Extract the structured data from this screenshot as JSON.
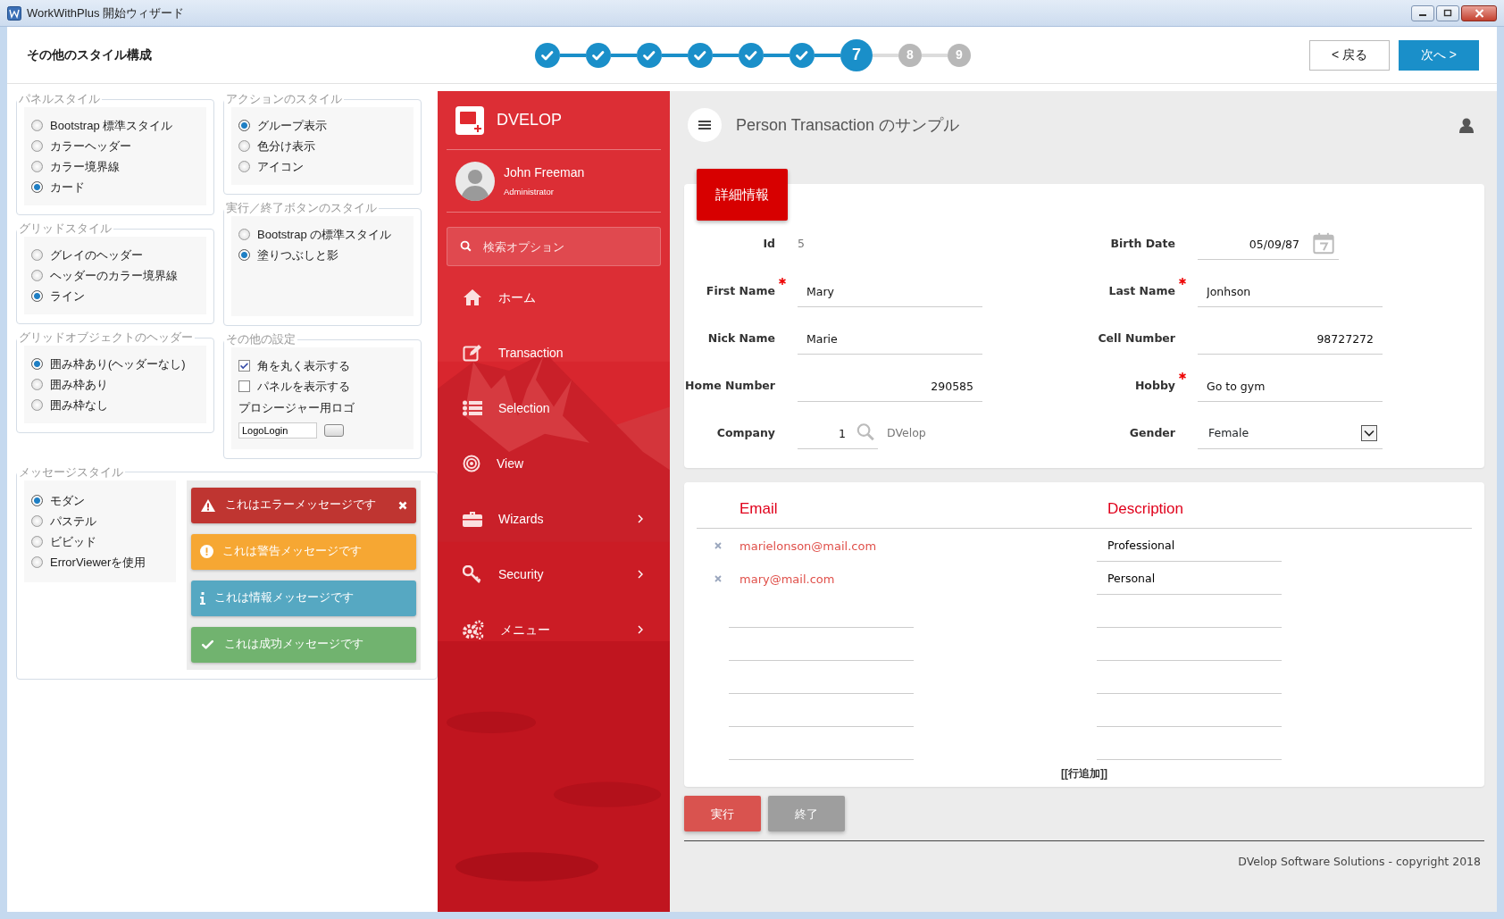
{
  "window": {
    "title": "WorkWithPlus 開始ウィザード"
  },
  "header": {
    "title": "その他のスタイル構成",
    "steps": [
      {
        "done": true,
        "selected": false
      },
      {
        "done": true,
        "selected": false
      },
      {
        "done": true,
        "selected": false
      },
      {
        "done": true,
        "selected": false
      },
      {
        "done": true,
        "selected": false
      },
      {
        "done": true,
        "selected": false
      },
      {
        "done": false,
        "selected": true,
        "label": "7"
      },
      {
        "done": false,
        "selected": false,
        "label": "8"
      },
      {
        "done": false,
        "selected": false,
        "label": "9"
      }
    ],
    "buttons": [
      {
        "label": "< 戻る",
        "kind": "back"
      },
      {
        "label": "次へ >",
        "kind": "next"
      }
    ]
  },
  "settings": {
    "columns": [
      [
        {
          "title": "パネルスタイル",
          "items": [
            {
              "kind": "radio",
              "label": "Bootstrap 標準スタイル",
              "selected": false
            },
            {
              "kind": "radio",
              "label": "カラーヘッダー",
              "selected": false
            },
            {
              "kind": "radio",
              "label": "カラー境界線",
              "selected": false
            },
            {
              "kind": "radio",
              "label": "カード",
              "selected": true
            }
          ]
        },
        {
          "title": "グリッドスタイル",
          "items": [
            {
              "kind": "radio",
              "label": "グレイのヘッダー",
              "selected": false
            },
            {
              "kind": "radio",
              "label": "ヘッダーのカラー境界線",
              "selected": false
            },
            {
              "kind": "radio",
              "label": "ライン",
              "selected": true
            }
          ]
        },
        {
          "title": "グリッドオブジェクトのヘッダー",
          "items": [
            {
              "kind": "radio",
              "label": "囲み枠あり(ヘッダーなし)",
              "selected": true
            },
            {
              "kind": "radio",
              "label": "囲み枠あり",
              "selected": false
            },
            {
              "kind": "radio",
              "label": "囲み枠なし",
              "selected": false
            }
          ]
        }
      ],
      [
        {
          "title": "アクションのスタイル",
          "items": [
            {
              "kind": "radio",
              "label": "グループ表示",
              "selected": true
            },
            {
              "kind": "radio",
              "label": "色分け表示",
              "selected": false
            },
            {
              "kind": "radio",
              "label": "アイコン",
              "selected": false
            }
          ]
        },
        {
          "title": "実行／終了ボタンのスタイル",
          "items": [
            {
              "kind": "radio",
              "label": "Bootstrap の標準スタイル",
              "selected": false
            },
            {
              "kind": "radio",
              "label": "塗りつぶしと影",
              "selected": true
            }
          ]
        },
        {
          "title": "その他の設定",
          "items": [
            {
              "kind": "checkbox",
              "label": "角を丸く表示する",
              "checked": true
            },
            {
              "kind": "checkbox",
              "label": "パネルを表示する",
              "checked": false
            },
            {
              "kind": "caption",
              "label": "プロシージャー用ロゴ"
            },
            {
              "kind": "file",
              "value": "LogoLogin"
            }
          ]
        }
      ]
    ],
    "message_style": {
      "title": "メッセージスタイル",
      "items": [
        {
          "kind": "radio",
          "label": "モダン",
          "selected": true
        },
        {
          "kind": "radio",
          "label": "パステル",
          "selected": false
        },
        {
          "kind": "radio",
          "label": "ビビッド",
          "selected": false
        },
        {
          "kind": "radio",
          "label": "ErrorViewerを使用",
          "selected": false
        }
      ],
      "messages": [
        {
          "kind": "error",
          "text": "これはエラーメッセージです",
          "dismissible": true
        },
        {
          "kind": "warning",
          "text": "これは警告メッセージです",
          "dismissible": false
        },
        {
          "kind": "info",
          "text": "これは情報メッセージです",
          "dismissible": false
        },
        {
          "kind": "success",
          "text": "これは成功メッセージです",
          "dismissible": false
        }
      ]
    }
  },
  "preview": {
    "sidebar": {
      "brand": "DVELOP",
      "user": {
        "name": "John Freeman",
        "role": "Administrator"
      },
      "search": {
        "placeholder": "検索オプション"
      },
      "menu": [
        {
          "label": "ホーム",
          "submenu": false
        },
        {
          "label": "Transaction",
          "submenu": false
        },
        {
          "label": "Selection",
          "submenu": false
        },
        {
          "label": "View",
          "submenu": false
        },
        {
          "label": "Wizards",
          "submenu": true
        },
        {
          "label": "Security",
          "submenu": true
        },
        {
          "label": "メニュー",
          "submenu": true
        }
      ]
    },
    "page": {
      "title": "Person Transaction のサンプル",
      "tab": "詳細情報",
      "fields": [
        {
          "label": "Id",
          "value": "5",
          "kind": "readonly",
          "required": false
        },
        {
          "label": "Birth Date",
          "value": "05/09/87",
          "kind": "date",
          "required": false
        },
        {
          "label": "First Name",
          "value": "Mary",
          "kind": "text",
          "required": true
        },
        {
          "label": "Last Name",
          "value": "Jonhson",
          "kind": "text",
          "required": true
        },
        {
          "label": "Nick Name",
          "value": "Marie",
          "kind": "text",
          "required": false
        },
        {
          "label": "Cell Number",
          "value": "98727272",
          "kind": "number",
          "required": false
        },
        {
          "label": "Home Number",
          "value": "290585",
          "kind": "number",
          "required": false
        },
        {
          "label": "Hobby",
          "value": "Go to gym",
          "kind": "text",
          "required": true
        },
        {
          "label": "Company",
          "value": "1",
          "kind": "prompt",
          "description": "DVelop",
          "required": false
        },
        {
          "label": "Gender",
          "value": "Female",
          "kind": "select",
          "required": false
        }
      ],
      "grid": {
        "columns": [
          "Email",
          "Description"
        ],
        "rows": [
          {
            "kind": "entry",
            "email": "marielonson@mail.com",
            "description": "Professional"
          },
          {
            "kind": "entry",
            "email": "mary@mail.com",
            "description": "Personal"
          },
          {
            "kind": "blank"
          },
          {
            "kind": "blank"
          },
          {
            "kind": "blank"
          },
          {
            "kind": "blank"
          },
          {
            "kind": "blank"
          }
        ],
        "add_row": "[[行追加]]"
      },
      "actions": [
        {
          "label": "実行",
          "kind": "confirm"
        },
        {
          "label": "終了",
          "kind": "cancel"
        }
      ],
      "footer": "DVelop Software Solutions - copyright 2018"
    }
  }
}
